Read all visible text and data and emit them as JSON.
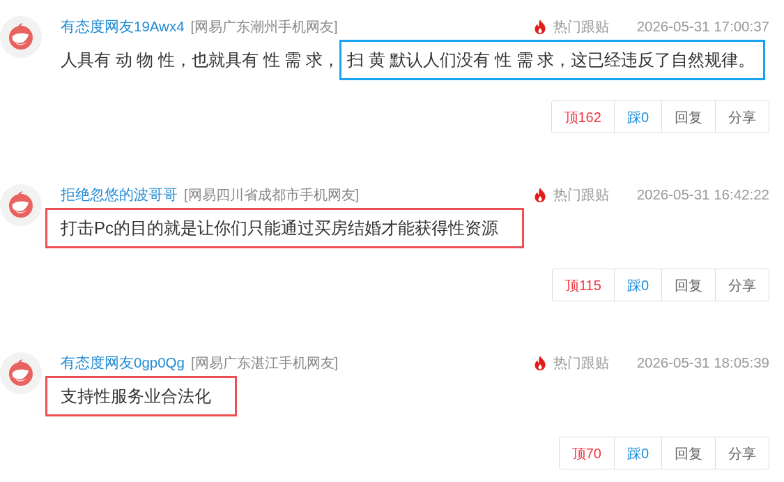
{
  "comments": [
    {
      "username": "有态度网友19Awx4",
      "location": "[网易广东潮州手机网友]",
      "badge": "热门跟贴",
      "time": "2026-05-31 17:00:37",
      "segments": [
        {
          "text": "人具有 动 物 性，也就具有 性 需 求，",
          "boxed": false
        },
        {
          "text": "扫 黄 默认人们没有 性 需 求，这已经违反了自然规律。",
          "boxed": true,
          "color": "#1aa3ee"
        }
      ],
      "actions": [
        {
          "kind": "up",
          "label": "顶162"
        },
        {
          "kind": "down",
          "label": "踩0"
        },
        {
          "kind": "reply",
          "label": "回复"
        },
        {
          "kind": "share",
          "label": "分享"
        }
      ]
    },
    {
      "username": "拒绝忽悠的波哥哥",
      "location": "[网易四川省成都市手机网友]",
      "badge": "热门跟贴",
      "time": "2026-05-31 16:42:22",
      "segments": [
        {
          "text": "打击Pc的目的就是让你们只能通过买房结婚才能获得性资源",
          "boxed": true,
          "color": "#ec4f54"
        }
      ],
      "actions": [
        {
          "kind": "up",
          "label": "顶115"
        },
        {
          "kind": "down",
          "label": "踩0"
        },
        {
          "kind": "reply",
          "label": "回复"
        },
        {
          "kind": "share",
          "label": "分享"
        }
      ]
    },
    {
      "username": "有态度网友0gp0Qg",
      "location": "[网易广东湛江手机网友]",
      "badge": "热门跟贴",
      "time": "2026-05-31 18:05:39",
      "segments": [
        {
          "text": "支持性服务业合法化",
          "boxed": true,
          "color": "#ec4f54"
        }
      ],
      "actions": [
        {
          "kind": "up",
          "label": "顶70"
        },
        {
          "kind": "down",
          "label": "踩0"
        },
        {
          "kind": "reply",
          "label": "回复"
        },
        {
          "kind": "share",
          "label": "分享"
        }
      ]
    }
  ]
}
